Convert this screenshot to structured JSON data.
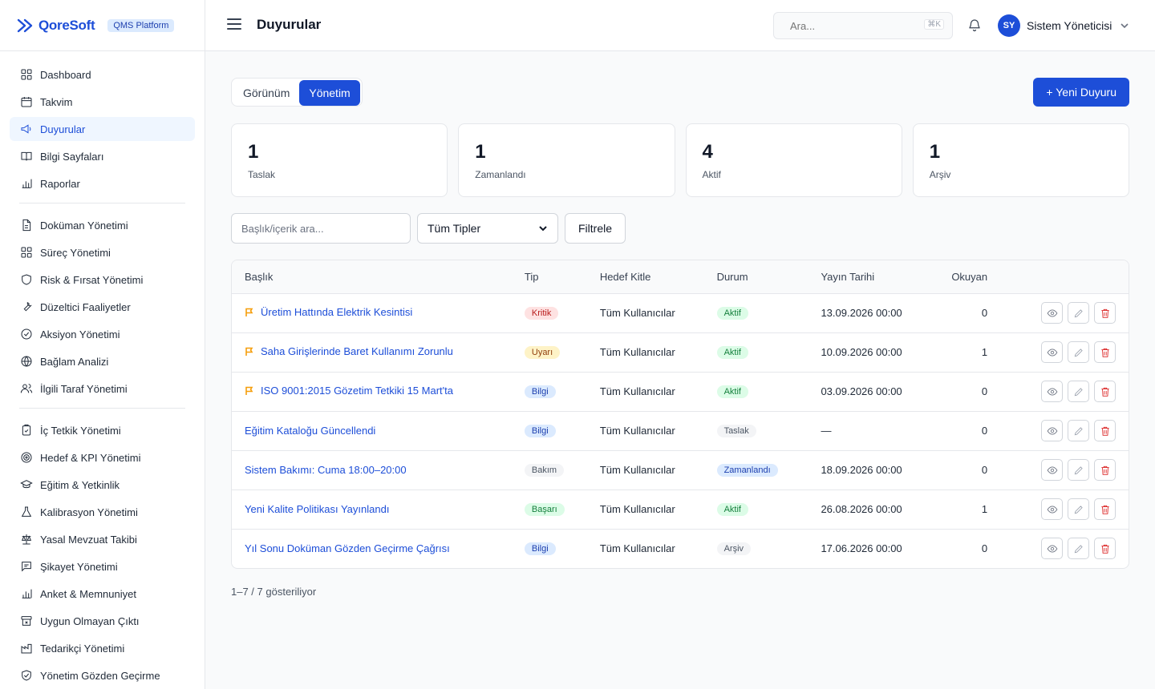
{
  "brand": {
    "name": "QoreSoft",
    "badge": "QMS Platform",
    "accent": "#1d4ed8"
  },
  "sidebar": {
    "groups": [
      [
        {
          "label": "Dashboard",
          "icon": "grid-icon"
        },
        {
          "label": "Takvim",
          "icon": "calendar-icon"
        },
        {
          "label": "Duyurular",
          "icon": "megaphone-icon",
          "active": true
        },
        {
          "label": "Bilgi Sayfaları",
          "icon": "book-icon"
        },
        {
          "label": "Raporlar",
          "icon": "bar-chart-icon"
        }
      ],
      [
        {
          "label": "Doküman Yönetimi",
          "icon": "file-icon"
        },
        {
          "label": "Süreç Yönetimi",
          "icon": "grid-icon"
        },
        {
          "label": "Risk & Fırsat Yönetimi",
          "icon": "shield-icon"
        },
        {
          "label": "Düzeltici Faaliyetler",
          "icon": "wrench-icon"
        },
        {
          "label": "Aksiyon Yönetimi",
          "icon": "check-circle-icon"
        },
        {
          "label": "Bağlam Analizi",
          "icon": "globe-icon"
        },
        {
          "label": "İlgili Taraf Yönetimi",
          "icon": "users-icon"
        }
      ],
      [
        {
          "label": "İç Tetkik Yönetimi",
          "icon": "clipboard-icon"
        },
        {
          "label": "Hedef & KPI Yönetimi",
          "icon": "target-icon"
        },
        {
          "label": "Eğitim & Yetkinlik",
          "icon": "graduation-cap-icon"
        },
        {
          "label": "Kalibrasyon Yönetimi",
          "icon": "flask-icon"
        },
        {
          "label": "Yasal Mevzuat Takibi",
          "icon": "scale-icon"
        },
        {
          "label": "Şikayet Yönetimi",
          "icon": "message-icon"
        },
        {
          "label": "Anket & Memnuniyet",
          "icon": "bar-chart-icon"
        },
        {
          "label": "Uygun Olmayan Çıktı",
          "icon": "archive-x-icon"
        },
        {
          "label": "Tedarikçi Yönetimi",
          "icon": "factory-icon"
        },
        {
          "label": "Yönetim Gözden Geçirme",
          "icon": "shield-check-icon"
        }
      ]
    ]
  },
  "header": {
    "title": "Duyurular",
    "search_placeholder": "Ara...",
    "search_shortcut": "⌘K",
    "user_initials": "SY",
    "user_name": "Sistem Yöneticisi"
  },
  "tabs": [
    {
      "label": "Görünüm"
    },
    {
      "label": "Yönetim",
      "active": true
    }
  ],
  "new_button": "+ Yeni Duyuru",
  "stats": [
    {
      "value": "1",
      "label": "Taslak"
    },
    {
      "value": "1",
      "label": "Zamanlandı"
    },
    {
      "value": "4",
      "label": "Aktif"
    },
    {
      "value": "1",
      "label": "Arşiv"
    }
  ],
  "filters": {
    "search_placeholder": "Başlık/içerik ara...",
    "type_selected": "Tüm Tipler",
    "filter_button": "Filtrele"
  },
  "table": {
    "columns": [
      "Başlık",
      "Tip",
      "Hedef Kitle",
      "Durum",
      "Yayın Tarihi",
      "Okuyan"
    ],
    "rows": [
      {
        "title": "Üretim Hattında Elektrik Kesintisi",
        "pinned": true,
        "type": "Kritik",
        "type_style": "b-red",
        "audience": "Tüm Kullanıcılar",
        "status": "Aktif",
        "status_style": "b-green",
        "date": "13.09.2026 00:00",
        "readers": "0"
      },
      {
        "title": "Saha Girişlerinde Baret Kullanımı Zorunlu",
        "pinned": true,
        "type": "Uyarı",
        "type_style": "b-amber",
        "audience": "Tüm Kullanıcılar",
        "status": "Aktif",
        "status_style": "b-green",
        "date": "10.09.2026 00:00",
        "readers": "1"
      },
      {
        "title": "ISO 9001:2015 Gözetim Tetkiki 15 Mart'ta",
        "pinned": true,
        "type": "Bilgi",
        "type_style": "b-blue",
        "audience": "Tüm Kullanıcılar",
        "status": "Aktif",
        "status_style": "b-green",
        "date": "03.09.2026 00:00",
        "readers": "0"
      },
      {
        "title": "Eğitim Kataloğu Güncellendi",
        "pinned": false,
        "type": "Bilgi",
        "type_style": "b-blue",
        "audience": "Tüm Kullanıcılar",
        "status": "Taslak",
        "status_style": "b-gray",
        "date": "—",
        "readers": "0"
      },
      {
        "title": "Sistem Bakımı: Cuma 18:00–20:00",
        "pinned": false,
        "type": "Bakım",
        "type_style": "b-gray",
        "audience": "Tüm Kullanıcılar",
        "status": "Zamanlandı",
        "status_style": "b-blue",
        "date": "18.09.2026 00:00",
        "readers": "0"
      },
      {
        "title": "Yeni Kalite Politikası Yayınlandı",
        "pinned": false,
        "type": "Başarı",
        "type_style": "b-green",
        "audience": "Tüm Kullanıcılar",
        "status": "Aktif",
        "status_style": "b-green",
        "date": "26.08.2026 00:00",
        "readers": "1"
      },
      {
        "title": "Yıl Sonu Doküman Gözden Geçirme Çağrısı",
        "pinned": false,
        "type": "Bilgi",
        "type_style": "b-blue",
        "audience": "Tüm Kullanıcılar",
        "status": "Arşiv",
        "status_style": "b-gray",
        "date": "17.06.2026 00:00",
        "readers": "0"
      }
    ]
  },
  "pagination": {
    "summary": "1–7 / 7 gösteriliyor"
  }
}
